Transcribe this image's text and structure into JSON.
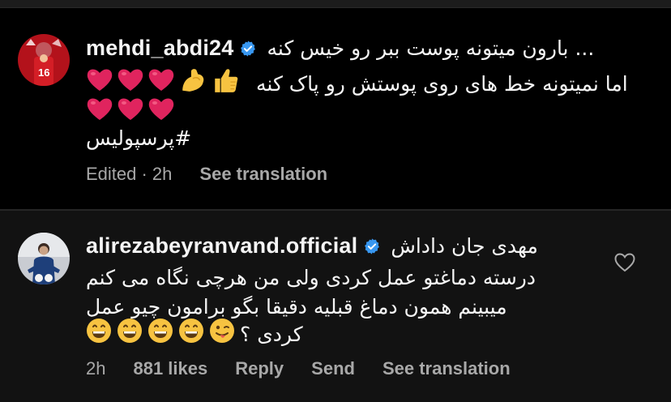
{
  "comments": [
    {
      "username": "mehdi_abdi24",
      "verified": true,
      "inline_text": "... بارون میتونه پوست ببر رو خیس کنه",
      "line2": "اما نمیتونه خط های روی پوستش رو پاک کنه",
      "hashtag": "#پرسپولیس",
      "avatar_number": "16",
      "meta": {
        "edited": "Edited · 2h",
        "see_translation": "See translation"
      }
    },
    {
      "username": "alirezabeyranvand.official",
      "verified": true,
      "inline_text": "مهدی جان داداش",
      "line2": "درسته دماغتو عمل کردی ولی من هرچی نگاه می کنم",
      "line3": "میبینم همون دماغ قبلیه دقیقا بگو برامون چیو عمل",
      "line4": "کردی ؟",
      "meta": {
        "time": "2h",
        "likes": "881 likes",
        "reply": "Reply",
        "send": "Send",
        "see_translation": "See translation"
      }
    }
  ],
  "colors": {
    "verified": "#3897f0",
    "heart": "#e0245e",
    "muted": "#a8a8a8"
  },
  "icons": [
    "verified-badge-icon",
    "heart-emoji-icon",
    "flexed-biceps-icon",
    "thumbs-up-icon",
    "grinning-emoji-icon",
    "winking-tongue-emoji-icon",
    "like-heart-outline-icon"
  ]
}
